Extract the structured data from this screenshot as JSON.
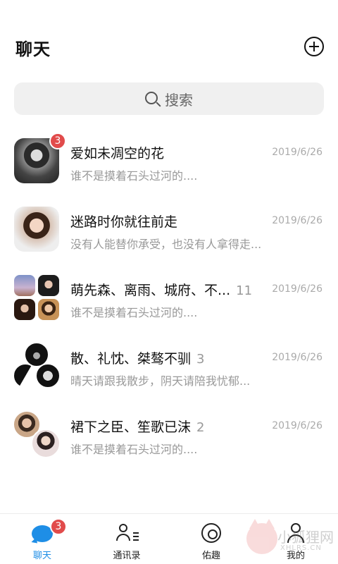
{
  "header": {
    "title": "聊天",
    "add_icon": "plus-circle-icon"
  },
  "search": {
    "placeholder": "搜索",
    "icon": "search-icon"
  },
  "chats": [
    {
      "name": "爱如未凋空的花",
      "count": "",
      "date": "2019/6/26",
      "preview": "谁不是摸着石头过河的....",
      "badge": "3"
    },
    {
      "name": "迷路时你就往前走",
      "count": "",
      "date": "2019/6/26",
      "preview": "没有人能替你承受，也没有人拿得走...",
      "badge": ""
    },
    {
      "name": "萌先森、离雨、城府、不...",
      "count": "11",
      "date": "2019/6/26",
      "preview": "谁不是摸着石头过河的....",
      "badge": ""
    },
    {
      "name": "散、礼忱、桀骜不驯",
      "count": "3",
      "date": "2019/6/26",
      "preview": "晴天请跟我散步，阴天请陪我忧郁...",
      "badge": ""
    },
    {
      "name": "裙下之臣、笙歌已沫",
      "count": "2",
      "date": "2019/6/26",
      "preview": "谁不是摸着石头过河的....",
      "badge": ""
    }
  ],
  "tabs": [
    {
      "label": "聊天",
      "icon": "chat-bubble-icon",
      "badge": "3",
      "active": true
    },
    {
      "label": "通讯录",
      "icon": "contacts-icon",
      "badge": "",
      "active": false
    },
    {
      "label": "佑趣",
      "icon": "explore-icon",
      "badge": "",
      "active": false
    },
    {
      "label": "我的",
      "icon": "profile-icon",
      "badge": "",
      "active": false
    }
  ],
  "watermark": {
    "text": "小狐狸网",
    "sub": "XHLRS.CN"
  },
  "colors": {
    "accent": "#1e8ee6",
    "badge": "#e14b4b",
    "search_bg": "#f0f0f0"
  }
}
